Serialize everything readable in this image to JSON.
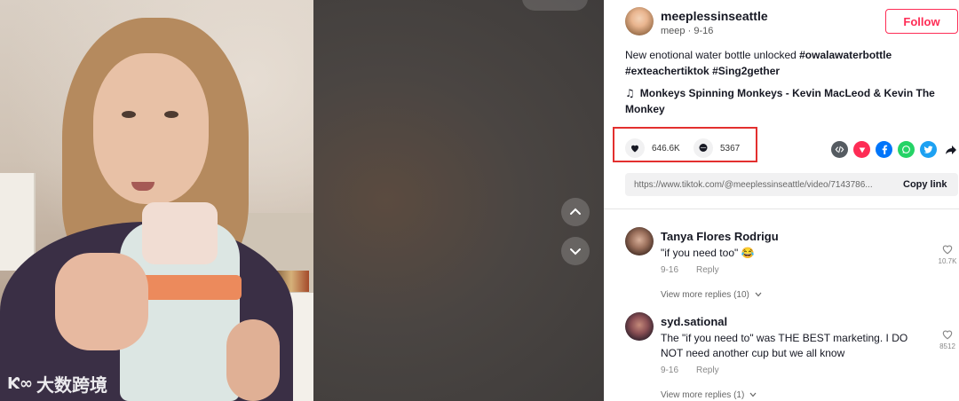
{
  "watermark": {
    "logo": "Ƙ∞",
    "text": "大数跨境"
  },
  "author": {
    "username": "meeplessinseattle",
    "nickname": "meep",
    "date": "9-16",
    "follow_label": "Follow"
  },
  "post": {
    "description_text": "New enotional water bottle unlocked ",
    "hashtags": [
      "#owalawaterbottle",
      "#exteachertiktok",
      "#Sing2gether"
    ],
    "music": "Monkeys Spinning Monkeys - Kevin MacLeod & Kevin The Monkey"
  },
  "stats": {
    "likes": "646.6K",
    "comments": "5367"
  },
  "share": {
    "icons": [
      "embed-icon",
      "tiktok-friends-icon",
      "facebook-icon",
      "whatsapp-icon",
      "twitter-icon",
      "share-arrow-icon"
    ],
    "colors": {
      "embed": "#555b61",
      "friends": "#fe2c55",
      "facebook": "#0075fa",
      "whatsapp": "#25d366",
      "twitter": "#1da1f2"
    }
  },
  "link": {
    "url": "https://www.tiktok.com/@meeplessinseattle/video/7143786...",
    "copy_label": "Copy link"
  },
  "comments": [
    {
      "name": "Tanya Flores Rodrigu",
      "text": "\"if you need too\" 😂",
      "date": "9-16",
      "reply_label": "Reply",
      "likes": "10.7K",
      "view_replies": "View more replies (10)"
    },
    {
      "name": "syd.sational",
      "text": "The \"if you need to\" was THE BEST marketing. I DO NOT need another cup but we all know",
      "date": "9-16",
      "reply_label": "Reply",
      "likes": "8512",
      "view_replies": "View more replies (1)"
    }
  ],
  "colors": {
    "accent": "#fe2c55",
    "highlight_box": "#e3302f"
  }
}
